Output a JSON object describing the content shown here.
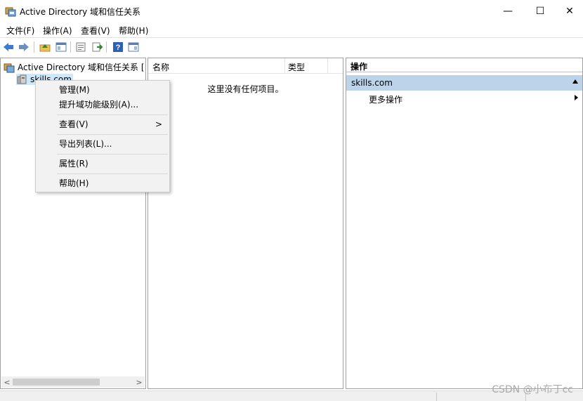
{
  "window": {
    "title": "Active Directory 域和信任关系",
    "minimize_glyph": "—",
    "maximize_glyph": "☐",
    "close_glyph": "✕"
  },
  "menubar": {
    "items": [
      "文件(F)",
      "操作(A)",
      "查看(V)",
      "帮助(H)"
    ]
  },
  "toolbar": {
    "icons": [
      "back-icon",
      "forward-icon",
      "up-folder-icon",
      "show-hide-tree-icon",
      "properties-icon",
      "export-list-icon",
      "help-icon",
      "show-hide-action-pane-icon"
    ]
  },
  "tree": {
    "root_label": "Active Directory 域和信任关系 [ d",
    "child_label": "skills.com",
    "scroll_left": "<",
    "scroll_right": ">"
  },
  "list": {
    "columns": [
      "名称",
      "类型"
    ],
    "empty_message": "这里没有任何项目。"
  },
  "actions": {
    "header": "操作",
    "section_label": "skills.com",
    "more_actions": "更多操作"
  },
  "context_menu": {
    "items": [
      "管理(M)",
      "提升域功能级别(A)...",
      "查看(V)",
      "导出列表(L)...",
      "属性(R)",
      "帮助(H)"
    ],
    "submenu_arrow": ">"
  },
  "watermark": "CSDN @小布丁cc",
  "colors": {
    "selection": "#cce8ff",
    "action_section": "#bcd3ea",
    "menu_bg": "#f2f2f2"
  }
}
